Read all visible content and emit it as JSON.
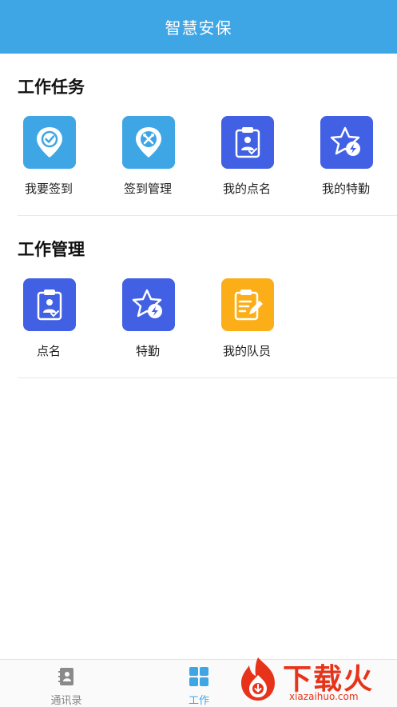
{
  "header": {
    "title": "智慧安保"
  },
  "sections": [
    {
      "title": "工作任务",
      "items": [
        {
          "label": "我要签到",
          "icon": "location-check-icon",
          "color": "#3fa6e6"
        },
        {
          "label": "签到管理",
          "icon": "location-tools-icon",
          "color": "#3fa6e6"
        },
        {
          "label": "我的点名",
          "icon": "clipboard-person-icon",
          "color": "#4160e4"
        },
        {
          "label": "我的特勤",
          "icon": "star-bolt-icon",
          "color": "#4160e4"
        }
      ]
    },
    {
      "title": "工作管理",
      "items": [
        {
          "label": "点名",
          "icon": "clipboard-person-icon",
          "color": "#4160e4"
        },
        {
          "label": "特勤",
          "icon": "star-bolt-icon",
          "color": "#4160e4"
        },
        {
          "label": "我的队员",
          "icon": "clipboard-edit-icon",
          "color": "#fcae18"
        }
      ]
    }
  ],
  "tabbar": {
    "items": [
      {
        "label": "通讯录",
        "icon": "contacts-book-icon",
        "active": false
      },
      {
        "label": "工作",
        "icon": "grid-icon",
        "active": true
      }
    ],
    "active_color": "#3fa6e6",
    "inactive_color": "#888888"
  },
  "watermark": {
    "text": "下载火",
    "url": "xiazaihuo.com",
    "color": "#e8331b"
  }
}
